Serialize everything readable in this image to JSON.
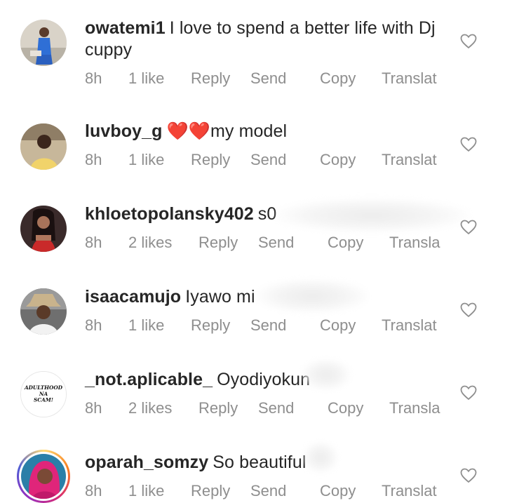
{
  "comments": [
    {
      "username": "owatemi1",
      "text": "I love to spend a better life with Dj cuppy",
      "time": "8h",
      "likes": "1 like",
      "reply": "Reply",
      "send": "Send",
      "copy": "Copy",
      "translate": "Translat"
    },
    {
      "username": "luvboy_g",
      "text": "❤️❤️my model",
      "time": "8h",
      "likes": "1 like",
      "reply": "Reply",
      "send": "Send",
      "copy": "Copy",
      "translate": "Translat"
    },
    {
      "username": "khloetopolansky402",
      "text": "s0",
      "time": "8h",
      "likes": "2 likes",
      "reply": "Reply",
      "send": "Send",
      "copy": "Copy",
      "translate": "Transla"
    },
    {
      "username": "isaacamujo",
      "text": "Iyawo mi",
      "time": "8h",
      "likes": "1 like",
      "reply": "Reply",
      "send": "Send",
      "copy": "Copy",
      "translate": "Translat"
    },
    {
      "username": "_not.aplicable_",
      "text": "Oyodiyokun",
      "time": "8h",
      "likes": "2 likes",
      "reply": "Reply",
      "send": "Send",
      "copy": "Copy",
      "translate": "Transla",
      "avatar_text": [
        "ADULTHOOD",
        "NA",
        "SCAM!"
      ]
    },
    {
      "username": "oparah_somzy",
      "text": "So beautiful",
      "time": "8h",
      "likes": "1 like",
      "reply": "Reply",
      "send": "Send",
      "copy": "Copy",
      "translate": "Translat"
    }
  ],
  "icons": {
    "like": "heart-outline-icon"
  },
  "colors": {
    "text": "#262626",
    "meta": "#8e8e8e",
    "heart": "#8e8e8e"
  }
}
